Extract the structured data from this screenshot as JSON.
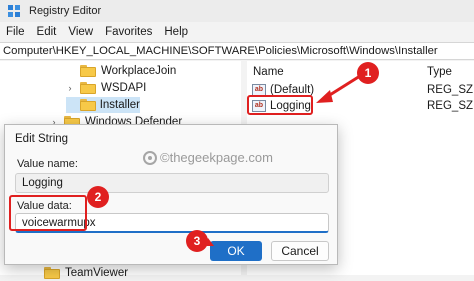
{
  "window": {
    "title": "Registry Editor"
  },
  "menu": [
    "File",
    "Edit",
    "View",
    "Favorites",
    "Help"
  ],
  "address": "Computer\\HKEY_LOCAL_MACHINE\\SOFTWARE\\Policies\\Microsoft\\Windows\\Installer",
  "tree": {
    "items": [
      {
        "label": "WorkplaceJoin",
        "chevron": ""
      },
      {
        "label": "WSDAPI",
        "chevron": "›"
      },
      {
        "label": "Installer",
        "chevron": "",
        "selected": true
      },
      {
        "label": "Windows Defender",
        "chevron": "›"
      },
      {
        "label": "TeamViewer",
        "chevron": ""
      }
    ]
  },
  "values_pane": {
    "columns": {
      "name": "Name",
      "type": "Type"
    },
    "rows": [
      {
        "name": "(Default)",
        "type": "REG_SZ",
        "icon": "string-value-icon"
      },
      {
        "name": "Logging",
        "type": "REG_SZ",
        "icon": "string-value-icon"
      }
    ]
  },
  "dialog": {
    "title": "Edit String",
    "value_name_label": "Value name:",
    "value_name": "Logging",
    "value_data_label": "Value data:",
    "value_data": "voicewarmupx",
    "ok_label": "OK",
    "cancel_label": "Cancel"
  },
  "watermark": "©thegeekpage.com",
  "annotations": {
    "step1": "1",
    "step2": "2",
    "step3": "3",
    "color": "#e02020"
  }
}
